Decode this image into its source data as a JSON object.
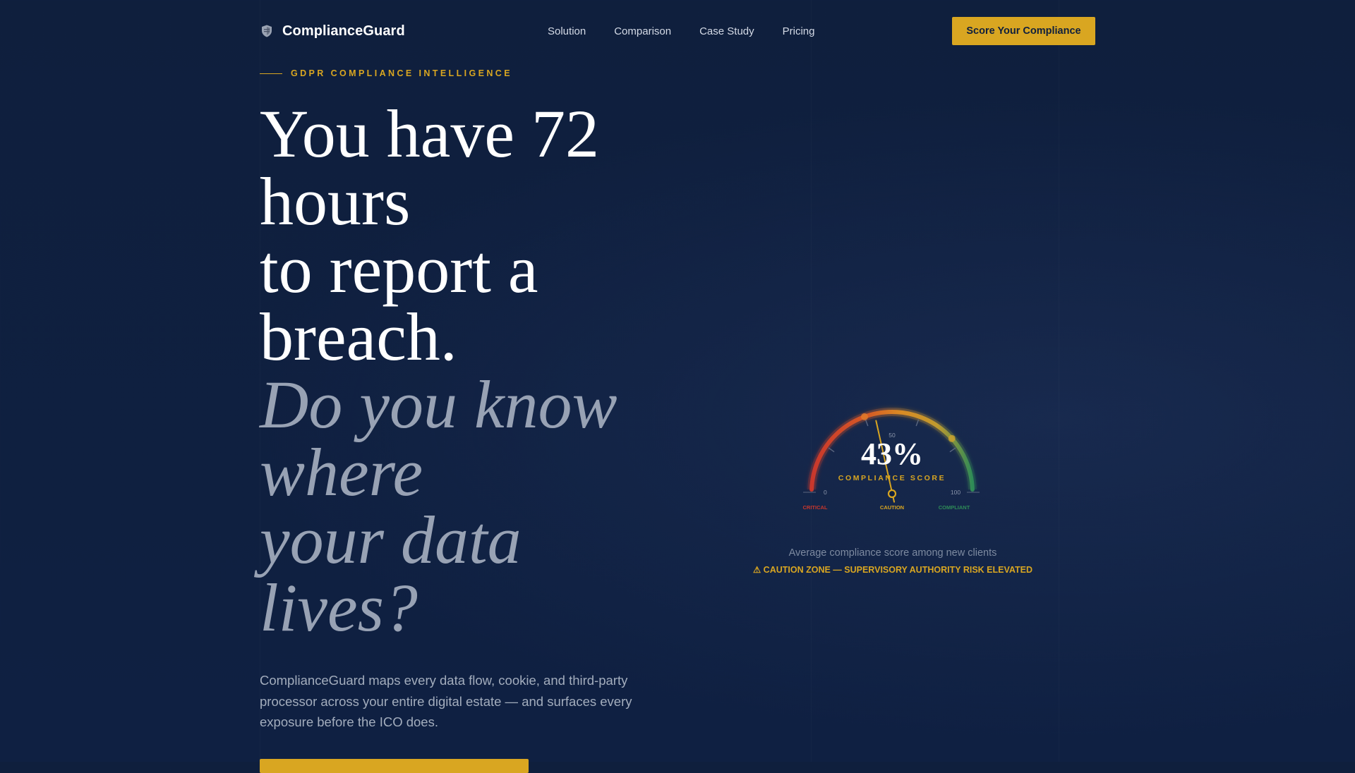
{
  "brand": {
    "name": "ComplianceGuard",
    "icon": "shield-icon"
  },
  "nav": {
    "links": [
      "Solution",
      "Comparison",
      "Case Study",
      "Pricing"
    ],
    "cta": "Score Your Compliance"
  },
  "hero": {
    "eyebrow": "GDPR COMPLIANCE INTELLIGENCE",
    "headline_lines": [
      "You have 72",
      "hours",
      "to report a",
      "breach."
    ],
    "question_lines": [
      "Do you know",
      "where",
      "your data",
      "lives?"
    ],
    "subtext": "ComplianceGuard maps every data flow, cookie, and third-party processor across your entire digital estate — and surfaces every exposure before the ICO does."
  },
  "gauge": {
    "value": 43,
    "min": 0,
    "max": 100,
    "display_value": "43%",
    "label": "COMPLIANCE SCORE",
    "tick_labels": {
      "min": "0",
      "mid": "50",
      "max": "100"
    },
    "zones": [
      "CRITICAL",
      "CAUTION",
      "COMPLIANT"
    ],
    "zone_colors": {
      "critical": "#c9372c",
      "caution": "#d9a621",
      "compliant": "#2e8b57"
    },
    "caption": "Average compliance score among new clients",
    "warning": "⚠ CAUTION ZONE — SUPERVISORY AUTHORITY RISK ELEVATED"
  },
  "colors": {
    "accent": "#d9a621",
    "background": "#0f1f3f",
    "text": "#ffffff",
    "muted": "#98a2b4"
  }
}
